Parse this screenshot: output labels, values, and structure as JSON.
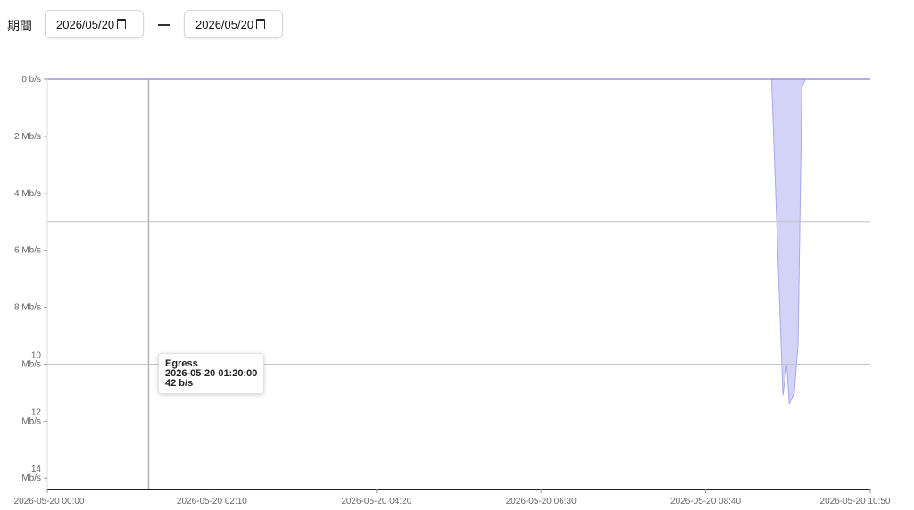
{
  "filter": {
    "period_label": "期間",
    "date_from": "2026/05/20",
    "date_to": "2026/05/20"
  },
  "tooltip": {
    "series": "Egress",
    "time": "2026-05-20 01:20:00",
    "value": "42 b/s"
  },
  "chart_data": {
    "type": "area",
    "title": "",
    "xlabel": "",
    "ylabel": "",
    "x_ticks": [
      "2026-05-20 00:00",
      "2026-05-20 02:10",
      "2026-05-20 04:20",
      "2026-05-20 06:30",
      "2026-05-20 08:40",
      "2026-05-20 10:50"
    ],
    "y_ticks": [
      "0 b/s",
      "2 Mb/s",
      "4 Mb/s",
      "6 Mb/s",
      "8 Mb/s",
      "10 Mb/s",
      "12 Mb/s",
      "14 Mb/s"
    ],
    "y_inverted": true,
    "xlim": [
      "2026-05-20 00:00",
      "2026-05-20 10:50"
    ],
    "ylim_mbps": [
      0,
      14.4
    ],
    "series": [
      {
        "name": "Egress",
        "color": "#a8a8f0",
        "x": [
          "2026-05-20 00:00",
          "2026-05-20 09:30",
          "2026-05-20 09:32",
          "2026-05-20 09:41",
          "2026-05-20 09:44",
          "2026-05-20 09:46",
          "2026-05-20 09:50",
          "2026-05-20 09:53",
          "2026-05-20 09:56",
          "2026-05-20 09:57",
          "2026-05-20 09:59",
          "2026-05-20 10:50"
        ],
        "y_mbps": [
          0,
          0,
          0,
          11.1,
          10.0,
          11.4,
          11.0,
          9.3,
          0.3,
          0.15,
          0,
          0
        ]
      }
    ],
    "crosshair": {
      "x": "2026-05-20 01:20",
      "y_mbps": 5.0
    },
    "grid": false,
    "legend": "none"
  }
}
